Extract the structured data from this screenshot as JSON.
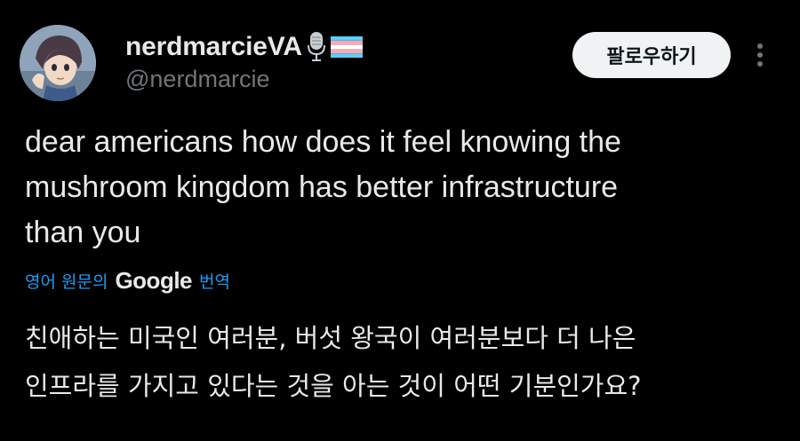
{
  "author": {
    "display_name": "nerdmarcieVA",
    "handle": "@nerdmarcie",
    "badges": [
      "microphone-icon",
      "transgender-flag-icon"
    ]
  },
  "actions": {
    "follow_label": "팔로우하기",
    "more_icon": "more-vertical-icon"
  },
  "tweet": {
    "text": "dear americans how does it feel knowing the\nmushroom kingdom has better infrastructure\nthan you"
  },
  "translation": {
    "prefix": "영어 원문의",
    "provider": "Google",
    "suffix": "번역",
    "text": "친애하는 미국인 여러분, 버섯 왕국이 여러분보다 더 나은\n인프라를 가지고 있다는 것을 아는 것이 어떤 기분인가요?"
  },
  "colors": {
    "background": "#000000",
    "primary_text": "#e7e9ea",
    "secondary_text": "#71767b",
    "link": "#1d9bf0",
    "follow_button_bg": "#eff3f4",
    "flag_blue": "#5bcefa",
    "flag_pink": "#f5a9b8",
    "flag_white": "#ffffff"
  }
}
